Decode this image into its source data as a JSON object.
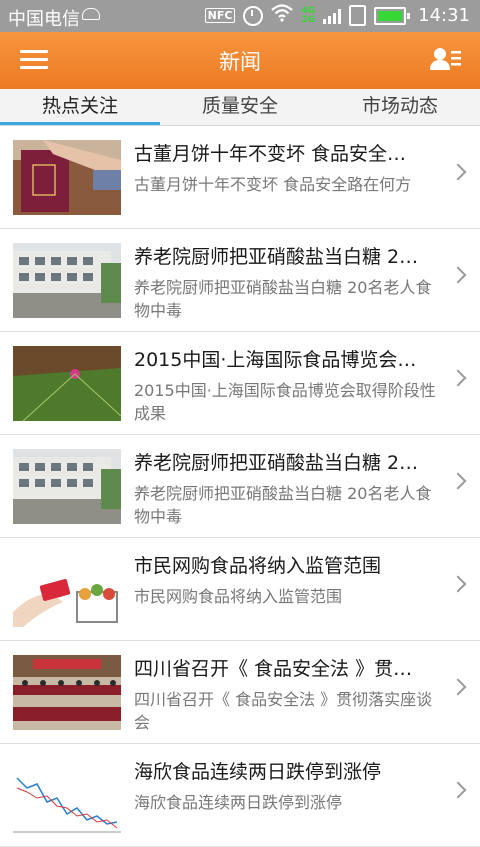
{
  "status_bar": {
    "carrier": "中国电信",
    "nfc": "NFC",
    "network": "4G\n2G",
    "time": "14:31"
  },
  "header": {
    "title": "新闻"
  },
  "tabs": [
    {
      "label": "热点关注",
      "active": true
    },
    {
      "label": "质量安全",
      "active": false
    },
    {
      "label": "市场动态",
      "active": false
    }
  ],
  "news": [
    {
      "title": "古董月饼十年不变坏 食品安全…",
      "summary": "古董月饼十年不变坏 食品安全路在何方"
    },
    {
      "title": "养老院厨师把亚硝酸盐当白糖 2…",
      "summary": "养老院厨师把亚硝酸盐当白糖 20名老人食物中毒"
    },
    {
      "title": "2015中国·上海国际食品博览会…",
      "summary": "2015中国·上海国际食品博览会取得阶段性成果"
    },
    {
      "title": "养老院厨师把亚硝酸盐当白糖 2…",
      "summary": "养老院厨师把亚硝酸盐当白糖 20名老人食物中毒"
    },
    {
      "title": "市民网购食品将纳入监管范围",
      "summary": "市民网购食品将纳入监管范围"
    },
    {
      "title": "四川省召开《 食品安全法 》贯…",
      "summary": "四川省召开《 食品安全法 》贯彻落实座谈会"
    },
    {
      "title": "海欣食品连续两日跌停到涨停",
      "summary": "海欣食品连续两日跌停到涨停"
    }
  ],
  "colors": {
    "header": "#ef8228",
    "tab_indicator": "#38a8dd",
    "status_bar": "#9c9c9c"
  }
}
